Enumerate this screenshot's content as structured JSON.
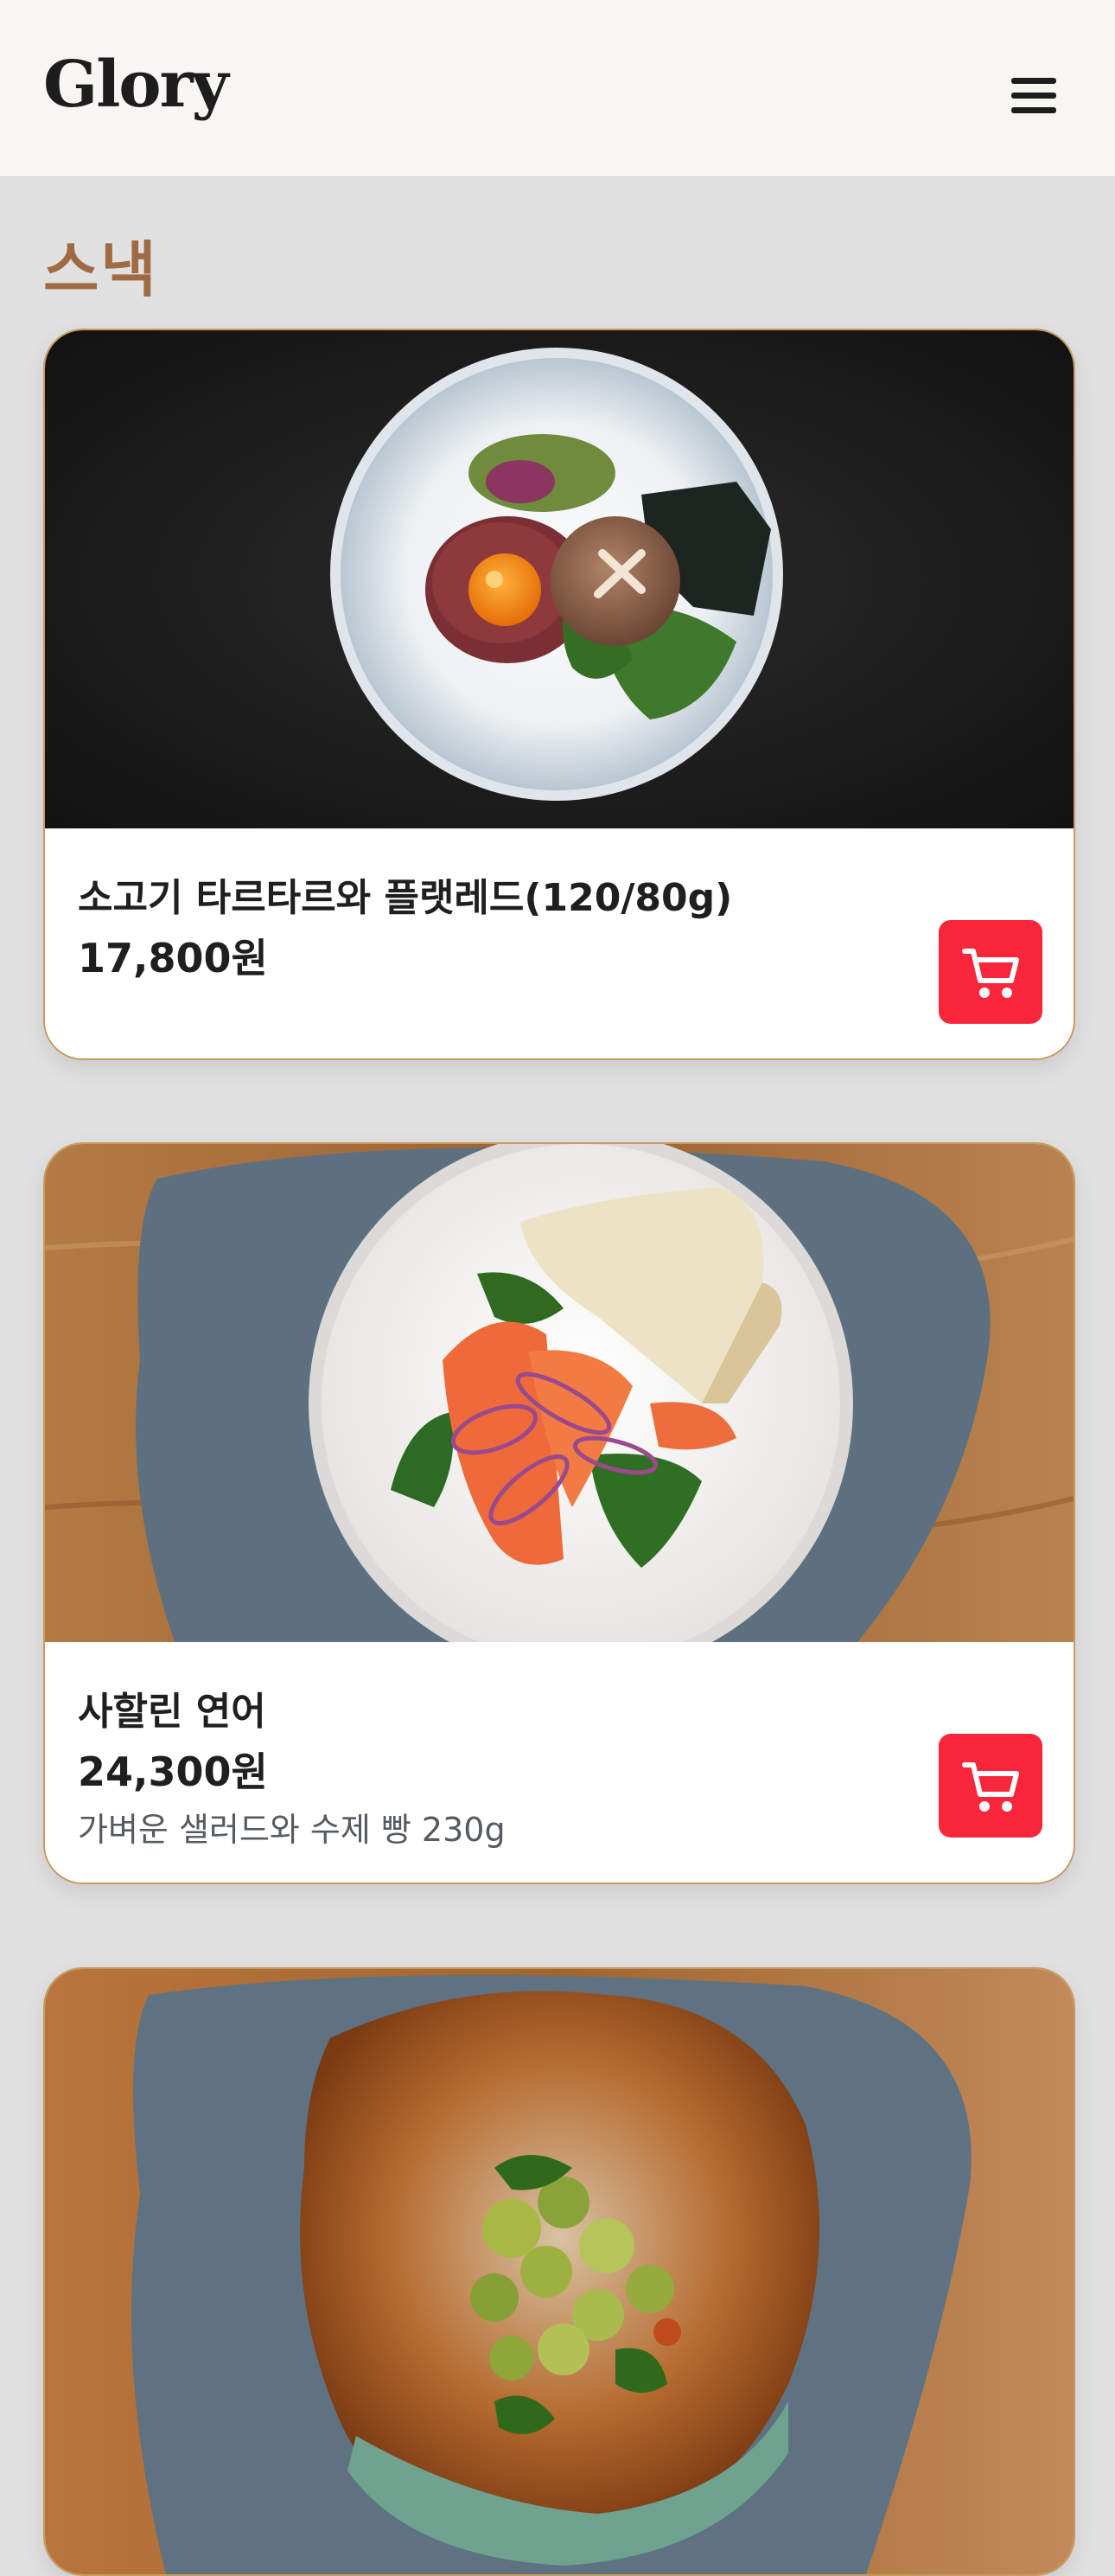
{
  "header": {
    "logo": "Glory",
    "menu_icon": "hamburger-menu-icon"
  },
  "section": {
    "title": "스낵"
  },
  "items": [
    {
      "name": "소고기 타르타르와 플랫레드(120/80g)",
      "price": "17,800원",
      "description": "",
      "cart_icon": "shopping-cart-icon"
    },
    {
      "name": "사할린 연어",
      "price": "24,300원",
      "description": "가벼운 샐러드와 수제 빵 230g",
      "cart_icon": "shopping-cart-icon"
    }
  ],
  "colors": {
    "accent_red": "#f7263a",
    "section_title": "#a06a43",
    "card_border": "#c79b5e",
    "background": "#e1e1e2"
  }
}
